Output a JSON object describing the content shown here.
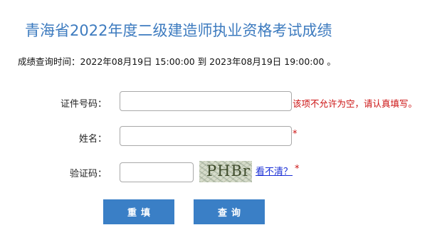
{
  "page": {
    "title": "青海省2022年度二级建造师执业资格考试成绩",
    "query_time": "成绩查询时间：2022年08月19日 15:00:00 到 2023年08月19日 19:00:00 。"
  },
  "form": {
    "id_label": "证件号码：",
    "id_value": "",
    "id_error": "该项不允许为空，请认真填写。",
    "name_label": "姓名：",
    "name_value": "",
    "name_required": "*",
    "captcha_label": "验证码：",
    "captcha_value": "",
    "captcha_image_text": "PHBr",
    "captcha_refresh": "看不清？",
    "captcha_required": "*"
  },
  "buttons": {
    "reset_label": "重填",
    "query_label": "查询"
  },
  "colors": {
    "title": "#3d7bbf",
    "error": "#cc1111",
    "button": "#3a7fc6",
    "link": "#1a2fd6"
  }
}
